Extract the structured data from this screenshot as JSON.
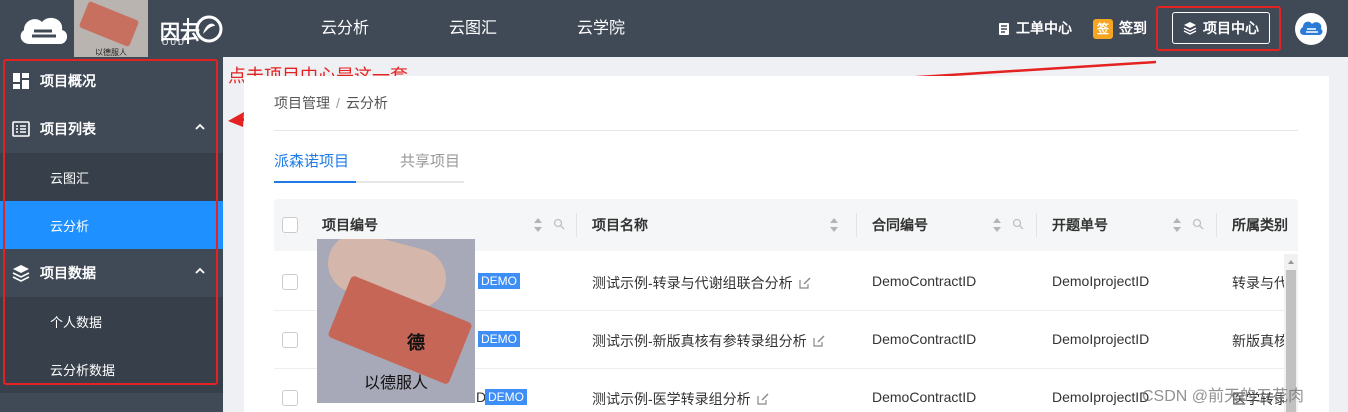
{
  "topbar": {
    "logo_text": "因云",
    "logo_sub": "OUD",
    "meme_caption": "以德服人",
    "nav": [
      "云分析",
      "云图汇",
      "云学院"
    ],
    "ticket_label": "工单中心",
    "checkin_label": "签到",
    "checkin_badge": "签",
    "project_center_label": "项目中心"
  },
  "sidebar": {
    "items": [
      {
        "label": "项目概况",
        "icon": "dashboard-icon"
      },
      {
        "label": "项目列表",
        "icon": "list-icon"
      },
      {
        "label": "云图汇",
        "icon": ""
      },
      {
        "label": "云分析",
        "icon": ""
      },
      {
        "label": "项目数据",
        "icon": "layers-icon"
      },
      {
        "label": "个人数据",
        "icon": ""
      },
      {
        "label": "云分析数据",
        "icon": ""
      }
    ],
    "active_item": "云分析"
  },
  "annotation": "点击项目中心是这一套",
  "breadcrumb": {
    "root": "项目管理",
    "separator": "/",
    "current": "云分析"
  },
  "tabs": [
    "派森诺项目",
    "共享项目"
  ],
  "table": {
    "columns": [
      "项目编号",
      "项目名称",
      "合同编号",
      "开题单号",
      "所属类别"
    ],
    "rows": [
      {
        "name": "测试示例-转录与代谢组联合分析",
        "contract": "DemoContractID",
        "project": "DemoIprojectID",
        "category": "转录与代",
        "tag": "DEMO"
      },
      {
        "name": "测试示例-新版真核有参转录组分析",
        "contract": "DemoContractID",
        "project": "DemoIprojectID",
        "category": "新版真核",
        "tag": "DEMO"
      },
      {
        "name": "测试示例-医学转录组分析",
        "contract": "DemoContractID",
        "project": "DemoIprojectID",
        "category": "医学转录",
        "tag": "DEMO",
        "id_tail": "D"
      }
    ]
  },
  "meme_big_caption": "以德服人",
  "meme_char": "德",
  "watermark": "CSDN @前天的五花肉",
  "colors": {
    "header_bg": "#404a57",
    "accent": "#1e90ff",
    "annotation": "#e52222",
    "demo_tag": "#3e8ef7"
  }
}
